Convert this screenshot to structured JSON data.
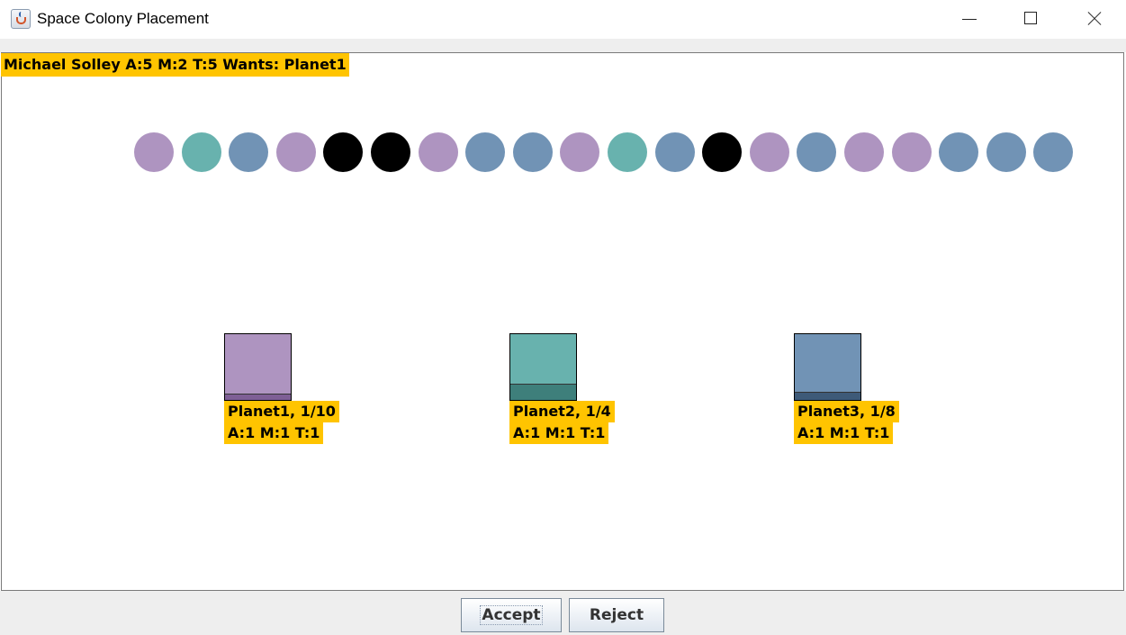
{
  "window": {
    "title": "Space Colony Placement"
  },
  "colonist": {
    "text": "Michael Solley A:5 M:2 T:5 Wants: Planet1"
  },
  "colors": {
    "purple": "#ae94c0",
    "teal": "#68b2ae",
    "blue": "#7193b5",
    "black": "#000000",
    "label_bg": "#ffc400"
  },
  "queue": [
    "purple",
    "teal",
    "blue",
    "purple",
    "black",
    "black",
    "purple",
    "blue",
    "blue",
    "purple",
    "teal",
    "blue",
    "black",
    "purple",
    "blue",
    "purple",
    "purple",
    "blue",
    "blue",
    "blue"
  ],
  "planets": [
    {
      "name_line": "Planet1, 1/10",
      "stats_line": "A:1 M:1 T:1",
      "color": "#ae94c0",
      "dark": "#7e5f95",
      "fill": 0.1
    },
    {
      "name_line": "Planet2, 1/4",
      "stats_line": "A:1 M:1 T:1",
      "color": "#68b2ae",
      "dark": "#3e7f7b",
      "fill": 0.25
    },
    {
      "name_line": "Planet3, 1/8",
      "stats_line": "A:1 M:1 T:1",
      "color": "#7193b5",
      "dark": "#3e5a78",
      "fill": 0.125
    }
  ],
  "buttons": {
    "accept": "Accept",
    "reject": "Reject"
  }
}
